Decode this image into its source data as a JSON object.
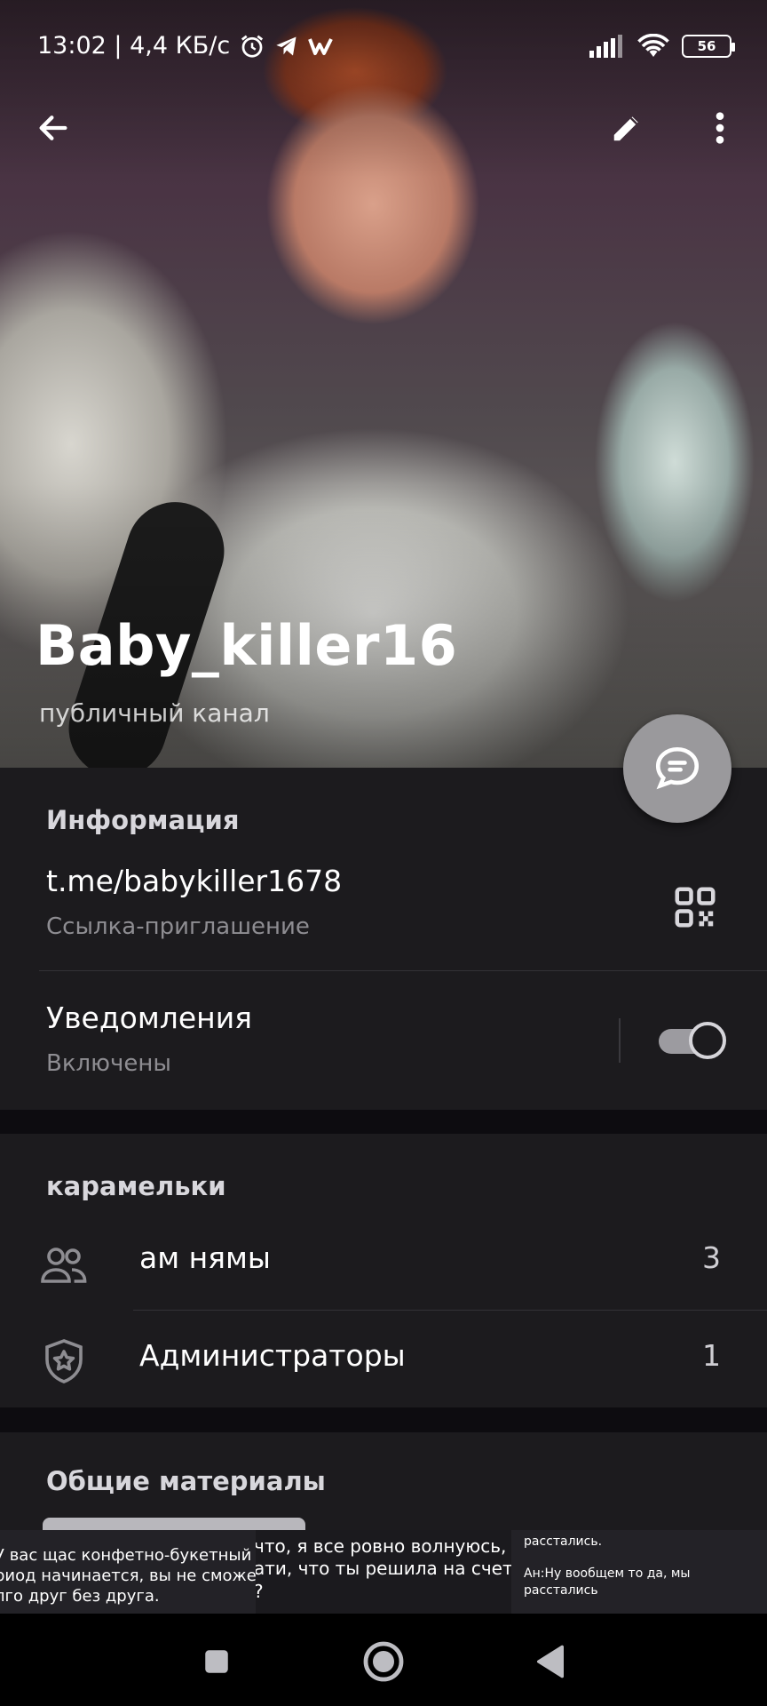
{
  "status_bar": {
    "time_speed": "13:02 | 4,4 КБ/с",
    "battery": "56",
    "icons": [
      "alarm-icon",
      "telegram-icon",
      "w-app-icon",
      "signal-icon",
      "wifi-icon",
      "battery-icon"
    ]
  },
  "appbar": {
    "back_icon": "arrow-back-icon",
    "edit_icon": "pencil-icon",
    "more_icon": "more-vertical-icon"
  },
  "channel": {
    "title": "Baby_killer16",
    "subtitle": "публичный канал"
  },
  "fab": {
    "icon": "chat-bubble-icon"
  },
  "info": {
    "header": "Информация",
    "link": "t.me/babykiller1678",
    "link_sub": "Ссылка-приглашение",
    "qr_icon": "qr-code-icon",
    "notifications_title": "Уведомления",
    "notifications_sub": "Включены",
    "notifications_enabled": true
  },
  "groups": {
    "header": "карамельки",
    "rows": [
      {
        "label": "ам нямы",
        "count": "3",
        "icon": "people-icon"
      },
      {
        "label": "Администраторы",
        "count": "1",
        "icon": "shield-star-icon"
      }
    ]
  },
  "media": {
    "header": "Общие материалы"
  },
  "captions": [
    "У вас щас конфетно-букетный\nриод начинается, вы не сможете\nлго друг без друга.",
    "что, я все ровно волнуюсь,\nати, что ты решила на счет\n?",
    "расстались.\n\nАн:Ну вообщем то да, мы\nрасстались"
  ],
  "nav": {
    "recents_icon": "square-recents-icon",
    "home_icon": "circle-home-icon",
    "back_icon": "triangle-back-icon"
  }
}
